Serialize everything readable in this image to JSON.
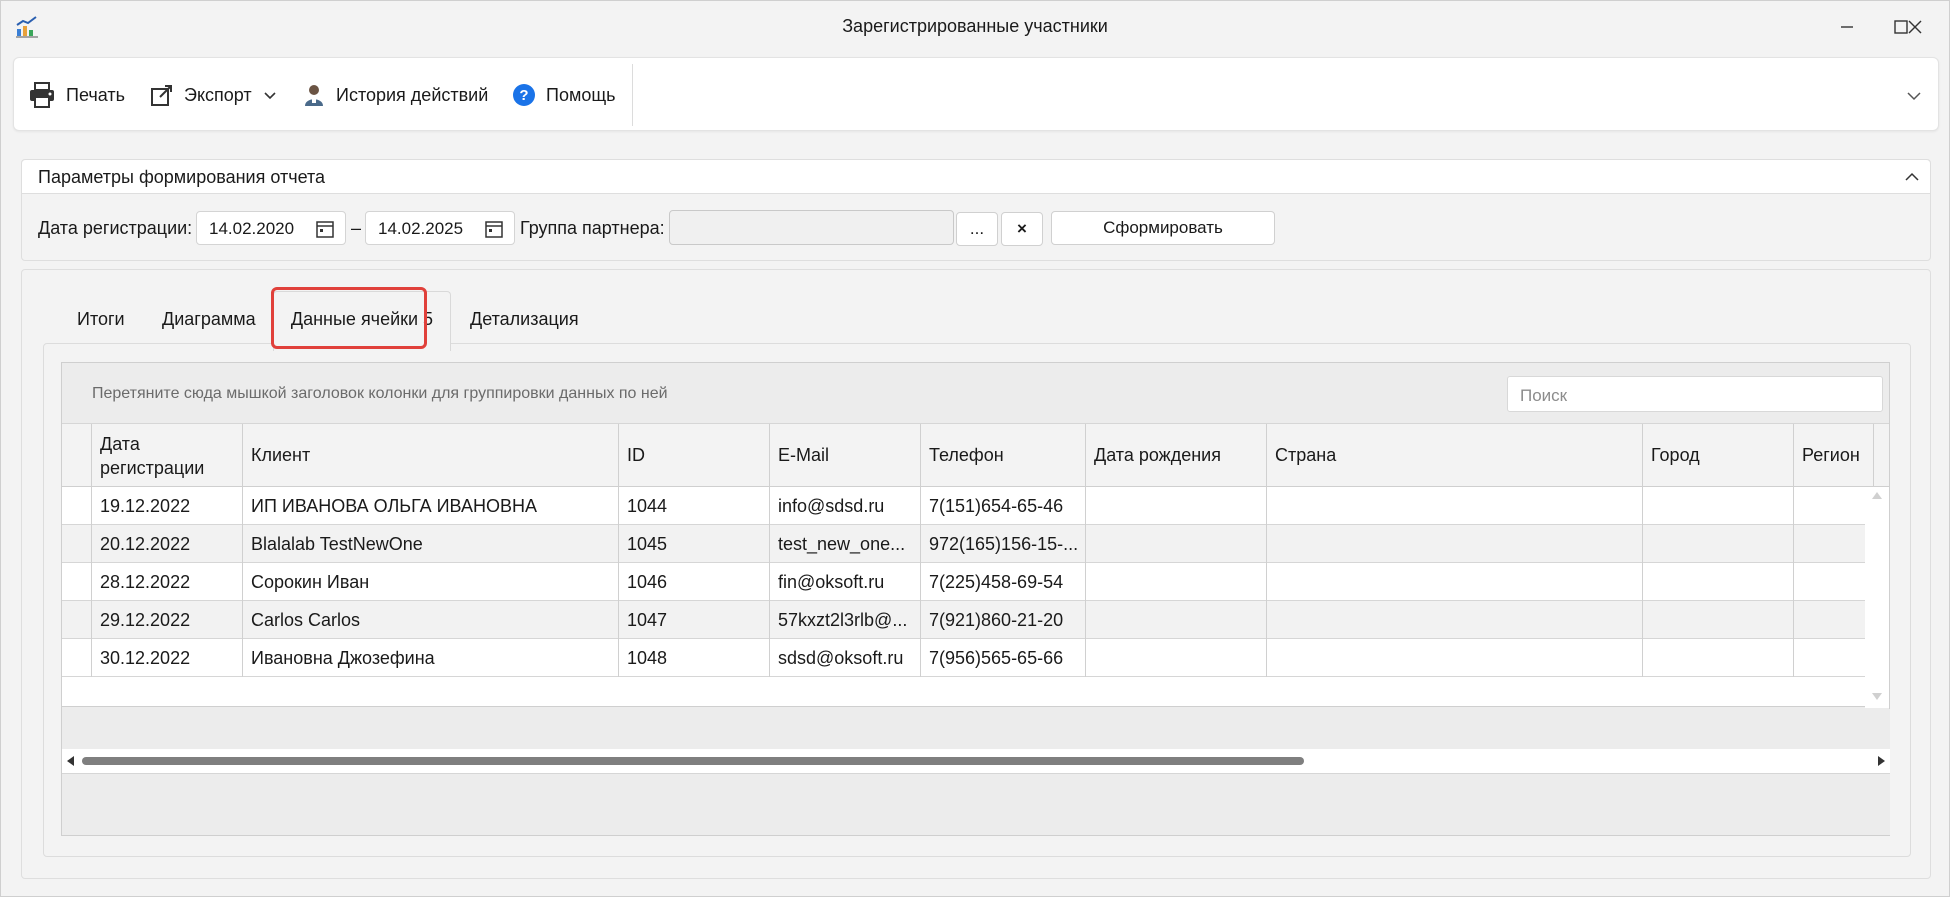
{
  "window": {
    "title": "Зарегистрированные участники",
    "app_icon": "chart-app-icon",
    "controls": [
      "minimize-icon",
      "maximize-icon",
      "close-icon"
    ]
  },
  "toolbar": {
    "print_label": "Печать",
    "export_label": "Экспорт",
    "history_label": "История действий",
    "help_label": "Помощь"
  },
  "params": {
    "title": "Параметры формирования отчета",
    "date_label": "Дата регистрации:",
    "date_from": "14.02.2020",
    "date_separator": "–",
    "date_to": "14.02.2025",
    "group_label": "Группа партнера:",
    "group_value": "",
    "browse_label": "...",
    "clear_label": "×",
    "generate_label": "Сформировать"
  },
  "tabs": [
    {
      "label": "Итоги",
      "active": false
    },
    {
      "label": "Диаграмма",
      "active": false
    },
    {
      "label": "Данные ячейки 5",
      "active": true
    },
    {
      "label": "Детализация",
      "active": false
    }
  ],
  "grid": {
    "group_hint": "Перетяните сюда мышкой заголовок колонки для группировки данных по ней",
    "search_placeholder": "Поиск",
    "columns": [
      {
        "line1": "Дата",
        "line2": "регистрации"
      },
      {
        "line1": "Клиент",
        "line2": ""
      },
      {
        "line1": "ID",
        "line2": ""
      },
      {
        "line1": "E-Mail",
        "line2": ""
      },
      {
        "line1": "Телефон",
        "line2": ""
      },
      {
        "line1": "Дата рождения",
        "line2": ""
      },
      {
        "line1": "Страна",
        "line2": ""
      },
      {
        "line1": "Город",
        "line2": ""
      },
      {
        "line1": "Регион",
        "line2": ""
      }
    ],
    "rows": [
      [
        "19.12.2022",
        "ИП ИВАНОВА ОЛЬГА ИВАНОВНА",
        "1044",
        "info@sdsd.ru",
        "7(151)654-65-46",
        "",
        "",
        "",
        ""
      ],
      [
        "20.12.2022",
        "Blalalab TestNewOne",
        "1045",
        "test_new_one...",
        "972(165)156-15-...",
        "",
        "",
        "",
        ""
      ],
      [
        "28.12.2022",
        "Сорокин Иван",
        "1046",
        "fin@oksoft.ru",
        "7(225)458-69-54",
        "",
        "",
        "",
        ""
      ],
      [
        "29.12.2022",
        "Carlos Carlos",
        "1047",
        "57kxzt2l3rlb@...",
        "7(921)860-21-20",
        "",
        "",
        "",
        ""
      ],
      [
        "30.12.2022",
        "Ивановна Джозефина",
        "1048",
        "sdsd@oksoft.ru",
        "7(956)565-65-66",
        "",
        "",
        "",
        ""
      ]
    ]
  }
}
